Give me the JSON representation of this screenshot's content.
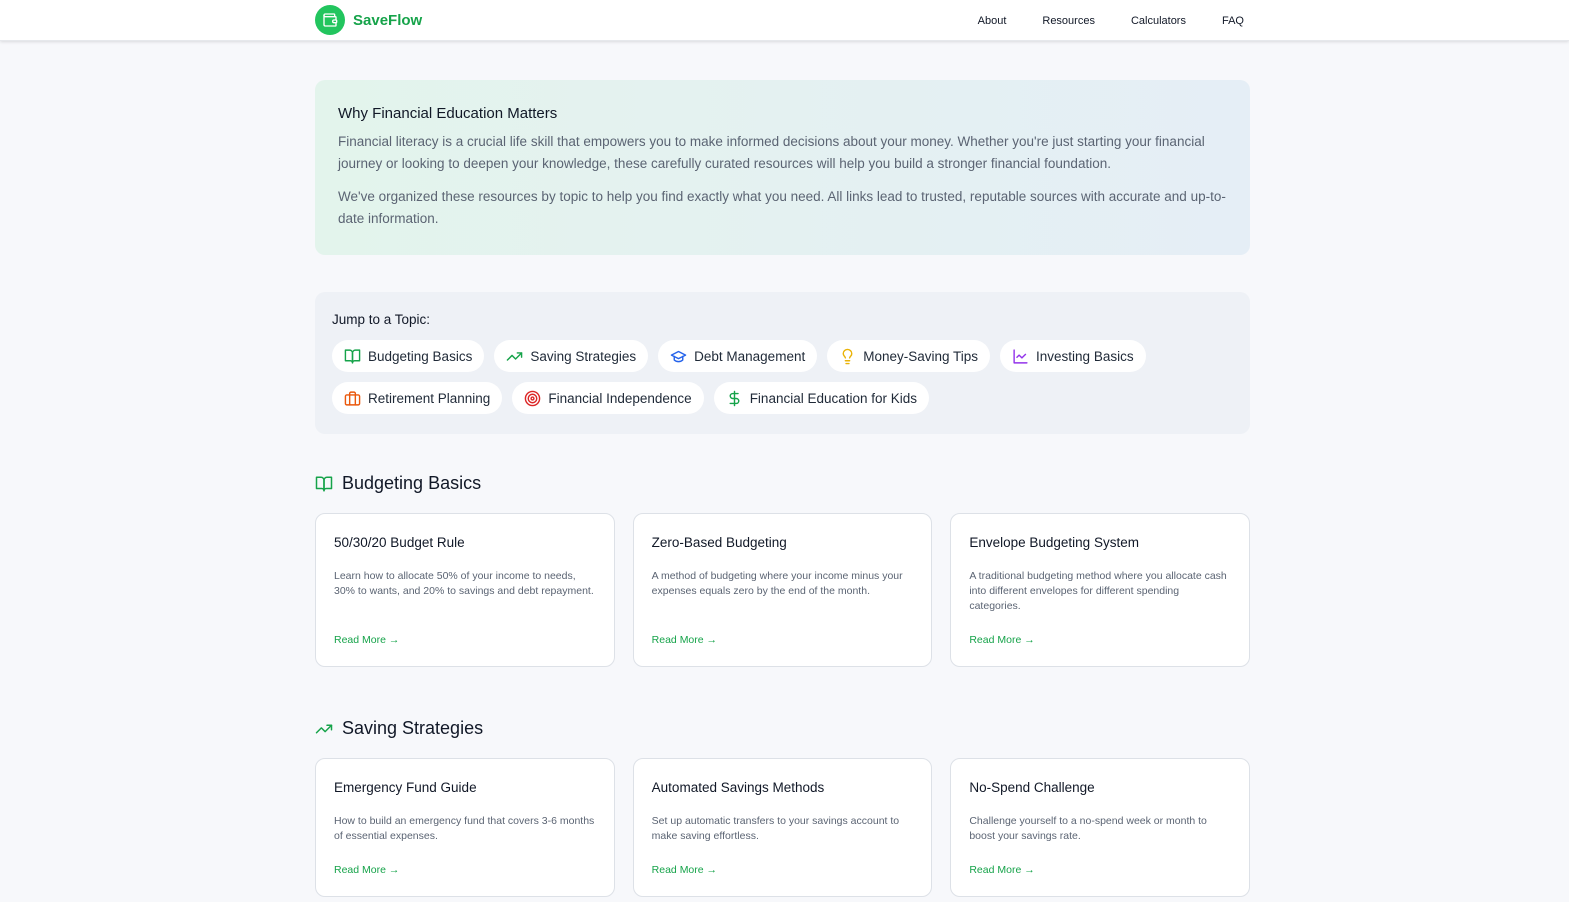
{
  "brand": {
    "name": "SaveFlow",
    "logo_icon": "wallet-icon"
  },
  "nav": [
    {
      "label": "About"
    },
    {
      "label": "Resources"
    },
    {
      "label": "Calculators"
    },
    {
      "label": "FAQ"
    }
  ],
  "intro": {
    "title": "Why Financial Education Matters",
    "p1": "Financial literacy is a crucial life skill that empowers you to make informed decisions about your money. Whether you're just starting your financial journey or looking to deepen your knowledge, these carefully curated resources will help you build a stronger financial foundation.",
    "p2": "We've organized these resources by topic to help you find exactly what you need. All links lead to trusted, reputable sources with accurate and up-to-date information."
  },
  "jump": {
    "title": "Jump to a Topic:",
    "topics": [
      {
        "label": "Budgeting Basics",
        "icon": "book-open-icon",
        "color": "#16a34a"
      },
      {
        "label": "Saving Strategies",
        "icon": "trending-up-icon",
        "color": "#16a34a"
      },
      {
        "label": "Debt Management",
        "icon": "graduation-cap-icon",
        "color": "#2563eb"
      },
      {
        "label": "Money-Saving Tips",
        "icon": "lightbulb-icon",
        "color": "#eab308"
      },
      {
        "label": "Investing Basics",
        "icon": "line-chart-icon",
        "color": "#9333ea"
      },
      {
        "label": "Retirement Planning",
        "icon": "briefcase-icon",
        "color": "#ea580c"
      },
      {
        "label": "Financial Independence",
        "icon": "target-icon",
        "color": "#dc2626"
      },
      {
        "label": "Financial Education for Kids",
        "icon": "dollar-sign-icon",
        "color": "#16a34a"
      }
    ]
  },
  "sections": {
    "budgeting": {
      "title": "Budgeting Basics",
      "icon": "book-open-icon",
      "cards": [
        {
          "title": "50/30/20 Budget Rule",
          "desc": "Learn how to allocate 50% of your income to needs, 30% to wants, and 20% to savings and debt repayment.",
          "link": "Read More →"
        },
        {
          "title": "Zero-Based Budgeting",
          "desc": "A method of budgeting where your income minus your expenses equals zero by the end of the month.",
          "link": "Read More →"
        },
        {
          "title": "Envelope Budgeting System",
          "desc": "A traditional budgeting method where you allocate cash into different envelopes for different spending categories.",
          "link": "Read More →"
        }
      ]
    },
    "saving": {
      "title": "Saving Strategies",
      "icon": "trending-up-icon",
      "cards": [
        {
          "title": "Emergency Fund Guide",
          "desc": "How to build an emergency fund that covers 3-6 months of essential expenses.",
          "link": "Read More →"
        },
        {
          "title": "Automated Savings Methods",
          "desc": "Set up automatic transfers to your savings account to make saving effortless.",
          "link": "Read More →"
        },
        {
          "title": "No-Spend Challenge",
          "desc": "Challenge yourself to a no-spend week or month to boost your savings rate.",
          "link": "Read More →"
        }
      ]
    }
  }
}
